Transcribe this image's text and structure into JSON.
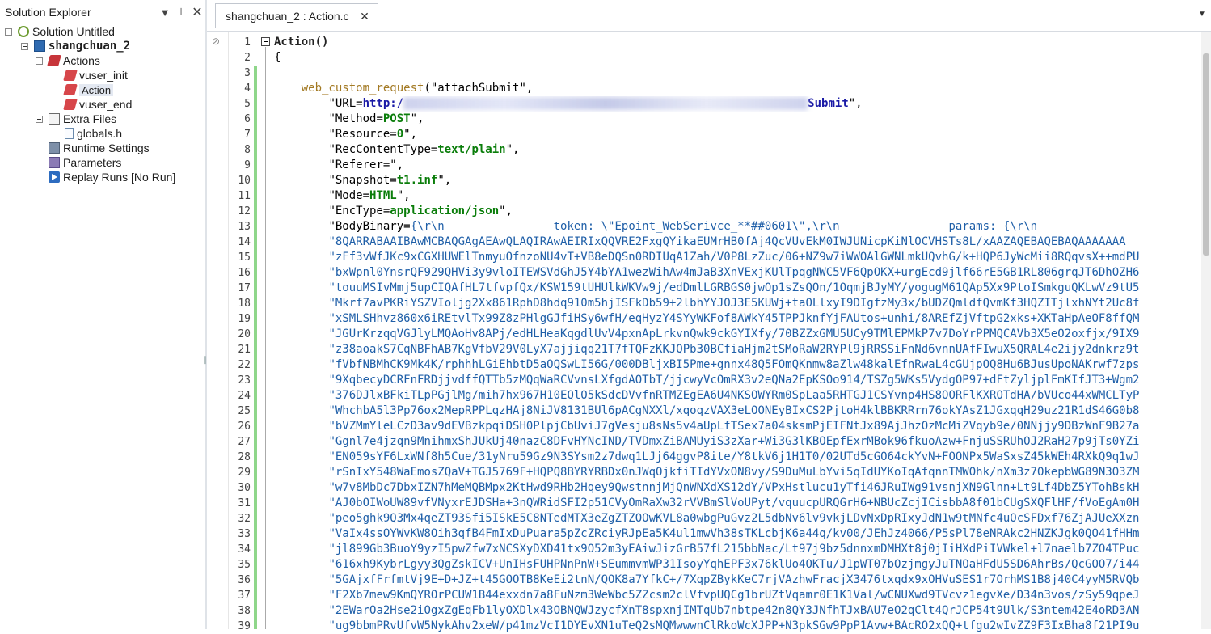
{
  "solution_explorer": {
    "title": "Solution Explorer",
    "tree": {
      "solution": "Solution Untitled",
      "project": "shangchuan_2",
      "actions_folder": "Actions",
      "actions": [
        "vuser_init",
        "Action",
        "vuser_end"
      ],
      "extra_files_folder": "Extra Files",
      "extra_files": [
        "globals.h"
      ],
      "runtime_settings": "Runtime Settings",
      "parameters": "Parameters",
      "replay_runs": "Replay Runs [No Run]"
    },
    "selected_item": "Action"
  },
  "editor": {
    "tab_label": "shangchuan_2 : Action.c",
    "line_numbers": [
      "1",
      "2",
      "3",
      "4",
      "5",
      "6",
      "7",
      "8",
      "9",
      "10",
      "11",
      "12",
      "13",
      "14",
      "15",
      "16",
      "17",
      "18",
      "19",
      "20",
      "21",
      "22",
      "23",
      "24",
      "25",
      "26",
      "27",
      "28",
      "29",
      "30",
      "31",
      "32",
      "33",
      "34",
      "35",
      "36",
      "37",
      "38",
      "39"
    ],
    "code": {
      "l1": "Action()",
      "l2": "{",
      "l4_fn": "web_custom_request",
      "l4_rest": "(\"attachSubmit\",",
      "l5_pre": "\"URL=",
      "l5_url_a": "http:/",
      "l5_url_b": "Submit",
      "l5_post": "\",",
      "l6_key": "\"Method=",
      "l6_val": "POST",
      "l7_key": "\"Resource=",
      "l7_val": "0",
      "l8_key": "\"RecContentType=",
      "l8_val": "text/plain",
      "l9": "\"Referer=\",",
      "l10_key": "\"Snapshot=",
      "l10_val": "t1.inf",
      "l11_key": "\"Mode=",
      "l11_val": "HTML",
      "l12_key": "\"EncType=",
      "l12_val": "application/json",
      "l13_key": "\"BodyBinary=",
      "l13_val": "{\\r\\n                token: \\\"Epoint_WebSerivce_**##0601\\\",\\r\\n                params: {\\r\\n",
      "body_lines": [
        "\"8QARRABAAIBAwMCBAQGAgAEAwQLAQIRAwAEIRIxQQVRE2FxgQYikaEUMrHB0fAj4QcVUvEkM0IWJUNicpKiNlOCVHSTs8L/xAAZAQEBAQEBAQAAAAAAA",
        "\"zFf3vWfJKc9xCGXHUWElTnmyuOfnzoNU4vT+VB8eDQSn0RDIUqA1Zah/V0P8LzZuc/06+NZ9w7iWWOAlGWNLmkUQvhG/k+HQP6JyWcMii8RQqvsX++mdPU",
        "\"bxWpnl0YnsrQF929QHVi3y9vloITEWSVdGhJ5Y4bYA1wezWihAw4mJaB3XnVExjKUlTpqgNWC5VF6QpOKX+urgEcd9jlf66rE5GB1RL806grqJT6DhOZH6",
        "\"touuMSIvMmj5upCIQAfHL7tfvpfQx/KSW159tUHUlkWKVw9j/edDmlLGRBGS0jwOp1sZsQOn/1OqmjBJyMY/yogugM61QAp5Xx9PtoISmkguQKLwVz9tU5",
        "\"Mkrf7avPKRiYSZVIoljg2Xx861RphD8hdq910m5hjISFkDb59+2lbhYYJOJ3E5KUWj+taOLlxyI9DIgfzMy3x/bUDZQmldfQvmKf3HQZITjlxhNYt2Uc8f",
        "\"xSMLSHhvz860x6iREtvlTx99Z8zPHlgGJfiHSy6wfH/eqHyzY4SYyWKFof8AWkY45TPPJknfYjFAUtos+unhi/8AREfZjVftpG2xks+XKTaHpAeOF8ffQM",
        "\"JGUrKrzqqVGJlyLMQAoHv8APj/edHLHeaKqgdlUvV4pxnApLrkvnQwk9ckGYIXfy/70BZZxGMU5UCy9TMlEPMkP7v7DoYrPPMQCAVb3X5eO2oxfjx/9IX9",
        "\"z38aoakS7CqNBFhAB7KgVfbV29V0LyX7ajjiqq21T7fTQFzKKJQPb30BCfiaHjm2tSMoRaW2RYPl9jRRSSiFnNd6vnnUAfFIwuX5QRAL4e2ijy2dnkrz9t",
        "\"fVbfNBMhCK9Mk4K/rphhhLGiEhbtD5aOQSwLI56G/000DBljxBI5Pme+gnnx48Q5FOmQKnmw8aZlw48kalEfnRwaL4cGUjpOQ8Hu6BJusUpoNAKrwf7zps",
        "\"9XqbecyDCRFnFRDjjvdffQTTb5zMQqWaRCVvnsLXfgdAOTbT/jjcwyVcOmRX3v2eQNa2EpKSOo914/TSZg5WKs5VydgOP97+dFtZyljplFmKIfJT3+Wgm2",
        "\"376DJlxBFkiTLpPGjlMg/mih7hx967H10EQlO5kSdcDVvfnRTMZEgEA6U4NKSOWYRm0SpLaa5RHTGJ1CSYvnp4HS8OORFlKXROTdHA/bVUco44xWMCLTyP",
        "\"WhchbA5l3Pp76ox2MepRPPLqzHAj8NiJV8131BUl6pACgNXXl/xqoqzVAX3eLOONEyBIxCS2PjtoH4klBBKRRrn76okYAsZ1JGxqqH29uz21R1dS46G0b8",
        "\"bVZMmYleLCzD3av9dEVBzkpqiDSH0PlpjCbUviJ7gVesju8sNs5v4aUpLfTSex7a04sksmPjEIFNtJx89AjJhzOzMcMiZVqyb9e/0NNjjy9DBzWnF9B27a",
        "\"Ggnl7e4jzqn9MnihmxShJUkUj40nazC8DFvHYNcIND/TVDmxZiBAMUyiS3zXar+Wi3G3lKBOEpfExrMBok96fkuoAzw+FnjuSSRUhOJ2RaH27p9jTs0YZi",
        "\"EN059sYF6LxWNf8h5Cue/31yNru59Gz9N3SYsm2z7dwq1LJj64ggvP8ite/Y8tkV6j1H1T0/02UTd5cGO64ckYvN+FOONPx5WaSxsZ45kWEh4RXkQ9q1wJ",
        "\"rSnIxY548WaEmosZQaV+TGJ5769F+HQPQ8BYRYRBDx0nJWqOjkfiTIdYVxON8vy/S9DuMuLbYvi5qIdUYKoIqAfqnnTMWOhk/nXm3z7OkepbWG89N3O3ZM",
        "\"w7v8MbDc7DbxIZN7hMeMQBMpx2KtHwd9RHb2Hqey9QwstnnjMjQnWNXdXS12dY/VPxHstlucu1yTfi46JRuIWg91vsnjXN9Glnn+Lt9Lf4DbZ5YTohBskH",
        "\"AJ0bOIWoUW89vfVNyxrEJDSHa+3nQWRidSFI2p51CVyOmRaXw32rVVBmSlVoUPyt/vquucpURQGrH6+NBUcZcjICisbbA8f01bCUgSXQFlHF/fVoEgAm0H",
        "\"peo5ghk9Q3Mx4qeZT93Sfi5ISkE5C8NTedMTX3eZgZTZOOwKVL8a0wbgPuGvz2L5dbNv6lv9vkjLDvNxDpRIxyJdN1w9tMNfc4uOcSFDxf76ZjAJUeXXzn",
        "\"VaIx4ssOYWvKW8Oih3qfB4FmIxDuPuara5pZcZRciyRJpEa5K4ul1mwVh38sTKLcbjK6a44q/kv00/JEhJz4066/P5sPl78eNRAkc2HNZKJgk0QO41fHHm",
        "\"jl899Gb3BuoY9yzI5pwZfw7xNCSXyDXD41tx9O52m3yEAiwJizGrB57fL215bbNac/Lt97j9bz5dnnxmDMHXt8j0jIiHXdPiIVWkel+l7naelb7ZO4TPuc",
        "\"616xh9KybrLgyy3QgZskICV+UnIHsFUHPNnPnW+SEummvmWP31IsoyYqhEPF3x76klUo4OKTu/J1pWT07bOzjmgyJuTNOaHFdU5SD6AhrBs/QcGOO7/i44",
        "\"5GAjxfFrfmtVj9E+D+JZ+t45GOOTB8KeEi2tnN/QOK8a7YfkC+/7XqpZBykKeC7rjVAzhwFracjX3476txqdx9xOHVuSES1r7OrhMS1B8j40C4yyM5RVQb",
        "\"F2Xb7mew9KmQYROrPCUW1B44exxdn7a8FuNzm3WeWbc5ZZcsm2clVfvpUQCg1brUZtVqamr0E1K1Val/wCNUXwd9TVcvz1egvXe/D34n3vos/zSy59qpeJ",
        "\"2EWarOa2Hse2iOgxZgEqFb1lyOXDlx43OBNQWJzycfXnT8spxnjIMTqUb7nbtpe42n8QY3JNfhTJxBAU7eO2qClt4QrJCP54t9Ulk/S3ntem42E4oRD3AN",
        "\"ug9bbmPRvUfvW5NykAhv2xeW/p41mzVcI1DYEvXN1uTeQ2sMQMwwwnClRkoWcXJPP+N3pkSGw9PpP1Avw+BAcRO2xQQ+tfgu2wIvZZ9F3IxBha8f21PI9u"
      ]
    }
  }
}
